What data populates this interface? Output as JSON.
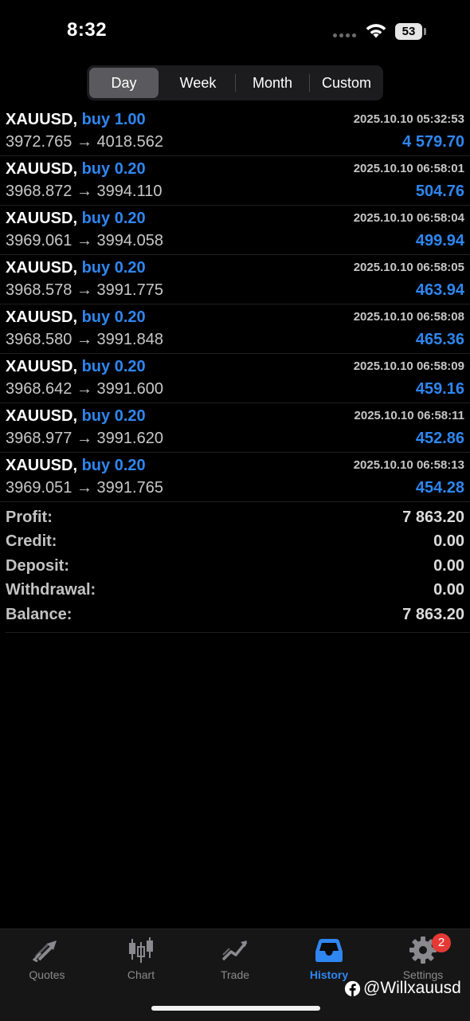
{
  "status_bar": {
    "time": "8:32",
    "battery": "53"
  },
  "tabs": {
    "items": [
      "Day",
      "Week",
      "Month",
      "Custom"
    ],
    "active": "Day"
  },
  "deals": [
    {
      "symbol": "XAUUSD,",
      "type": "buy 1.00",
      "time": "2025.10.10 05:32:53",
      "prices": "3972.765 → 4018.562",
      "profit": "4 579.70"
    },
    {
      "symbol": "XAUUSD,",
      "type": "buy 0.20",
      "time": "2025.10.10 06:58:01",
      "prices": "3968.872 → 3994.110",
      "profit": "504.76"
    },
    {
      "symbol": "XAUUSD,",
      "type": "buy 0.20",
      "time": "2025.10.10 06:58:04",
      "prices": "3969.061 → 3994.058",
      "profit": "499.94"
    },
    {
      "symbol": "XAUUSD,",
      "type": "buy 0.20",
      "time": "2025.10.10 06:58:05",
      "prices": "3968.578 → 3991.775",
      "profit": "463.94"
    },
    {
      "symbol": "XAUUSD,",
      "type": "buy 0.20",
      "time": "2025.10.10 06:58:08",
      "prices": "3968.580 → 3991.848",
      "profit": "465.36"
    },
    {
      "symbol": "XAUUSD,",
      "type": "buy 0.20",
      "time": "2025.10.10 06:58:09",
      "prices": "3968.642 → 3991.600",
      "profit": "459.16"
    },
    {
      "symbol": "XAUUSD,",
      "type": "buy 0.20",
      "time": "2025.10.10 06:58:11",
      "prices": "3968.977 → 3991.620",
      "profit": "452.86"
    },
    {
      "symbol": "XAUUSD,",
      "type": "buy 0.20",
      "time": "2025.10.10 06:58:13",
      "prices": "3969.051 → 3991.765",
      "profit": "454.28"
    }
  ],
  "summary": [
    {
      "label": "Profit:",
      "value": "7 863.20"
    },
    {
      "label": "Credit:",
      "value": "0.00"
    },
    {
      "label": "Deposit:",
      "value": "0.00"
    },
    {
      "label": "Withdrawal:",
      "value": "0.00"
    },
    {
      "label": "Balance:",
      "value": "7 863.20"
    }
  ],
  "tab_bar": {
    "items": [
      {
        "label": "Quotes",
        "icon": "quotes-arrows-icon"
      },
      {
        "label": "Chart",
        "icon": "candlestick-chart-icon"
      },
      {
        "label": "Trade",
        "icon": "trade-line-icon"
      },
      {
        "label": "History",
        "icon": "inbox-tray-icon"
      },
      {
        "label": "Settings",
        "icon": "gear-icon"
      }
    ],
    "active": "History",
    "settings_badge": "2"
  },
  "watermark": {
    "handle": "@Willxauusd",
    "icon": "facebook-icon"
  },
  "colors": {
    "background": "#000000",
    "accent_blue": "#2f86f0",
    "badge_red": "#e53935"
  }
}
